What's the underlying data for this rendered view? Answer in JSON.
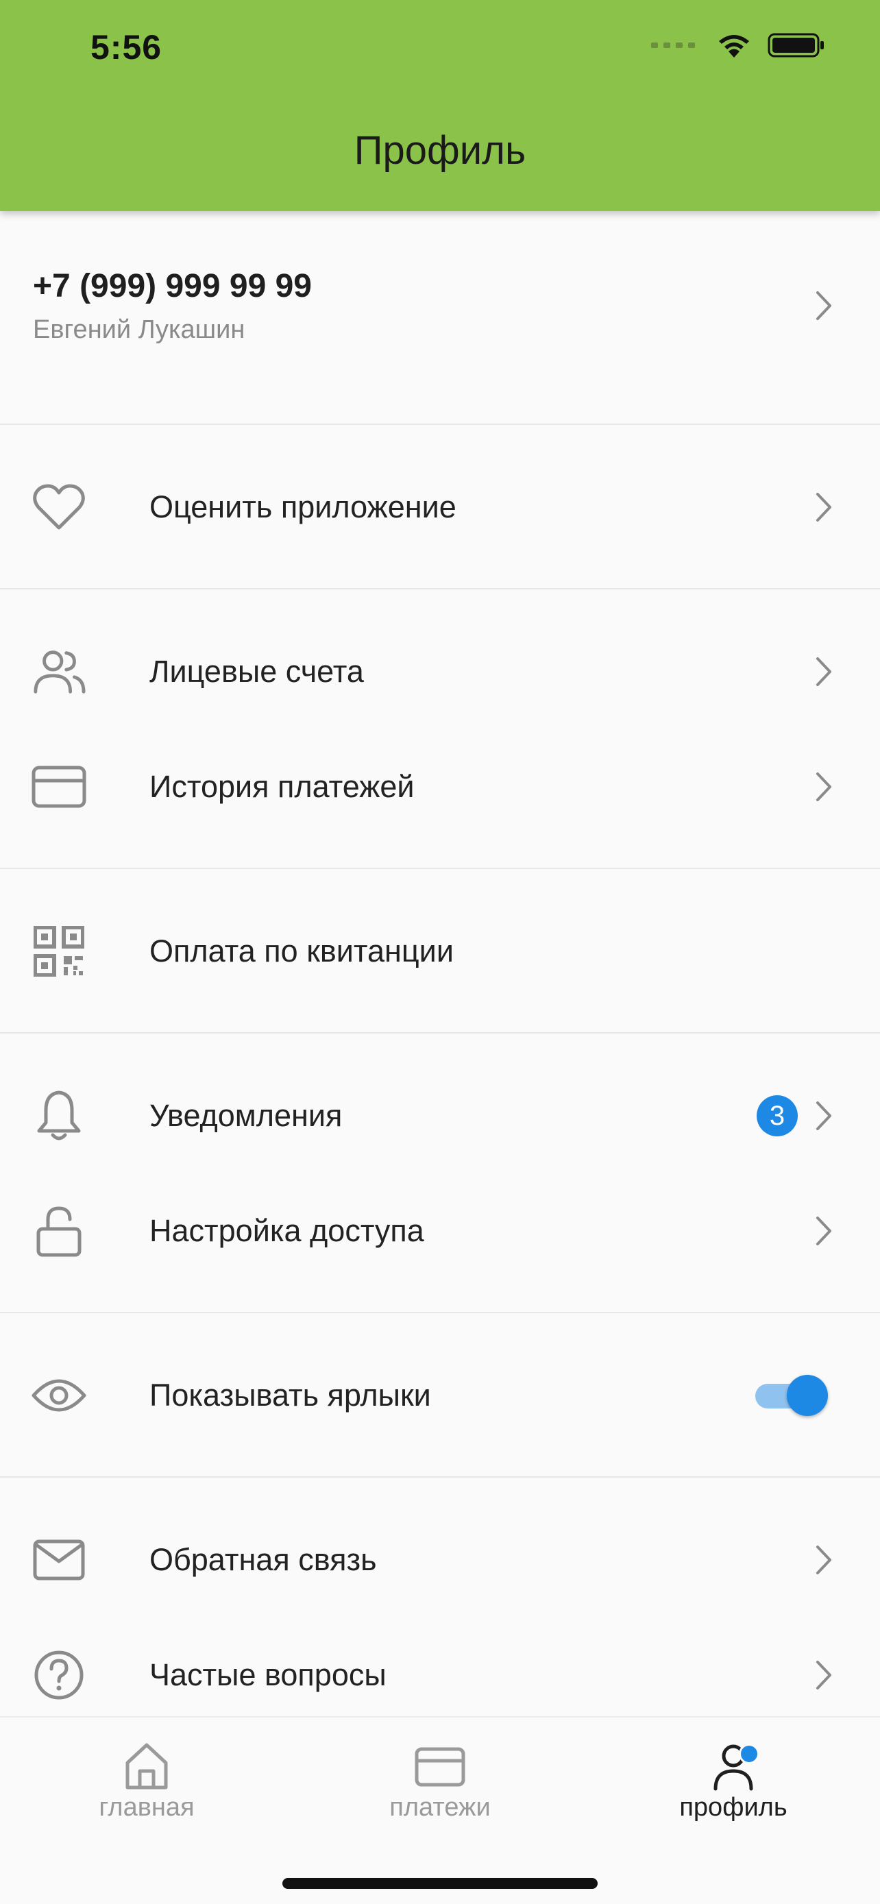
{
  "status_bar": {
    "time": "5:56"
  },
  "header": {
    "title": "Профиль"
  },
  "profile": {
    "phone": "+7 (999) 999 99 99",
    "name": "Евгений Лукашин"
  },
  "menu": {
    "rate": "Оценить приложение",
    "accounts": "Лицевые счета",
    "payment_history": "История платежей",
    "pay_receipt": "Оплата по квитанции",
    "notifications": "Уведомления",
    "notifications_badge": "3",
    "access_settings": "Настройка доступа",
    "show_labels": "Показывать ярлыки",
    "show_labels_on": true,
    "feedback": "Обратная связь",
    "faq": "Частые вопросы"
  },
  "tabbar": {
    "home": "главная",
    "payments": "платежи",
    "profile": "профиль"
  },
  "colors": {
    "header_bg": "#8bc34a",
    "accent": "#1e88e5",
    "toggle_track": "#90c2ef",
    "icon_gray": "#8a8a8a"
  }
}
